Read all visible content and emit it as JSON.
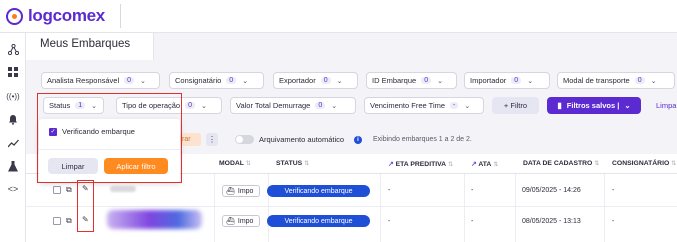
{
  "header": {
    "logo_text": "logcomex"
  },
  "sidebar": {
    "icons": [
      "network-icon",
      "grid-icon",
      "broadcast-icon",
      "bell-icon",
      "trend-icon",
      "flask-icon",
      "code-icon"
    ]
  },
  "page": {
    "title": "Meus Embarques"
  },
  "filters": {
    "row1": [
      {
        "label": "Analista Responsável",
        "count": "0"
      },
      {
        "label": "Consignatário",
        "count": "0"
      },
      {
        "label": "Exportador",
        "count": "0"
      },
      {
        "label": "ID Embarque",
        "count": "0"
      },
      {
        "label": "Importador",
        "count": "0"
      },
      {
        "label": "Modal de transporte",
        "count": "0"
      }
    ],
    "row2": [
      {
        "label": "Status",
        "count": "1"
      },
      {
        "label": "Tipo de operação",
        "count": "0"
      },
      {
        "label": "Valor Total Demurrage",
        "count": "0"
      },
      {
        "label": "Vencimento Free Time",
        "count": "-"
      }
    ],
    "add_filter": "+ Filtro",
    "saved_filters": "Filtros salvos |",
    "clear_link": "Limpa"
  },
  "status_dropdown": {
    "option": "Verificando embarque",
    "option_checked": true,
    "clear": "Limpar",
    "apply": "Aplicar filtro"
  },
  "toolbar": {
    "hidden_button": "rar",
    "more": "⋮",
    "archive_label": "Arquivamento automático",
    "archive_on": false,
    "showing": "Exibindo embarques 1 a 2 de 2."
  },
  "table": {
    "headers": [
      "MODAL",
      "STATUS",
      "ETA PREDITIVA",
      "ATA",
      "DATA DE CADASTRO",
      "CONSIGNATÁRIO"
    ],
    "rows": [
      {
        "modal": "Impo",
        "status": "Verificando embarque",
        "eta": "-",
        "ata": "-",
        "date": "09/05/2025 - 14:26",
        "consignee": "-"
      },
      {
        "modal": "Impo",
        "status": "Verificando embarque",
        "eta": "-",
        "ata": "-",
        "date": "08/05/2025 - 13:13",
        "consignee": "-"
      }
    ]
  },
  "colors": {
    "brand": "#5b2bd1",
    "accent": "#ff8a1f",
    "status": "#1f4fd6",
    "highlight": "#e03030"
  }
}
